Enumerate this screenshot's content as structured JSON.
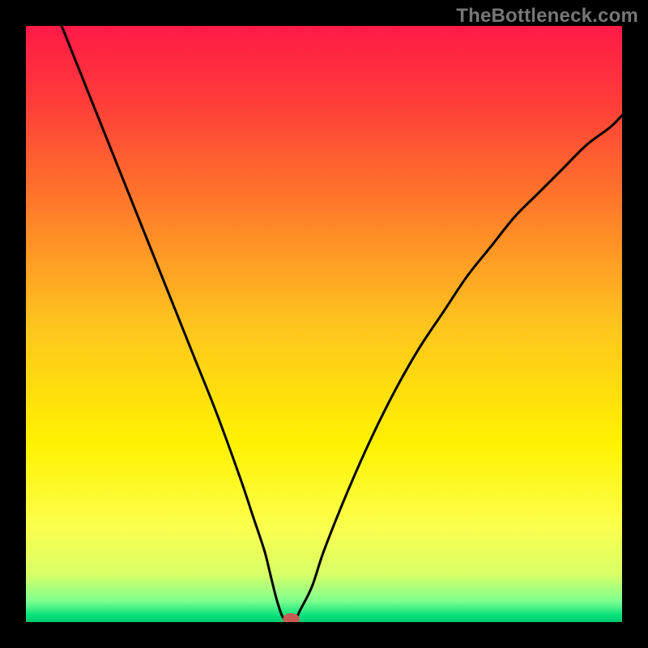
{
  "watermark": "TheBottleneck.com",
  "chart_data": {
    "type": "line",
    "title": "",
    "xlabel": "",
    "ylabel": "",
    "xlim": [
      0,
      100
    ],
    "ylim": [
      0,
      100
    ],
    "grid": false,
    "legend": false,
    "background_gradient_stops": [
      {
        "pos": 0.0,
        "color": "#ff1a47"
      },
      {
        "pos": 0.12,
        "color": "#ff3a3a"
      },
      {
        "pos": 0.3,
        "color": "#ff7a2a"
      },
      {
        "pos": 0.5,
        "color": "#ffc41e"
      },
      {
        "pos": 0.7,
        "color": "#fff200"
      },
      {
        "pos": 0.84,
        "color": "#fbff4d"
      },
      {
        "pos": 0.92,
        "color": "#d8ff66"
      },
      {
        "pos": 0.965,
        "color": "#7dff8f"
      },
      {
        "pos": 0.99,
        "color": "#00e07a"
      },
      {
        "pos": 1.0,
        "color": "#00c86e"
      }
    ],
    "series": [
      {
        "name": "bottleneck-curve",
        "color": "#000000",
        "width": 3,
        "x": [
          0,
          4,
          8,
          12,
          16,
          20,
          24,
          28,
          32,
          36,
          38,
          40,
          41,
          42,
          43,
          44,
          45,
          46,
          48,
          50,
          54,
          58,
          62,
          66,
          70,
          74,
          78,
          82,
          86,
          90,
          94,
          98,
          100
        ],
        "y": [
          115,
          105,
          95,
          85,
          75,
          65,
          55,
          45,
          35,
          24,
          18,
          12,
          8,
          4,
          1,
          0,
          0,
          2,
          6,
          12,
          22,
          31,
          39,
          46,
          52,
          58,
          63,
          68,
          72,
          76,
          80,
          83,
          85
        ]
      }
    ],
    "marker": {
      "name": "min-point-marker",
      "x": 44.5,
      "y": 0.5,
      "rx": 1.4,
      "ry": 1.0,
      "fill": "#c75a52"
    }
  }
}
